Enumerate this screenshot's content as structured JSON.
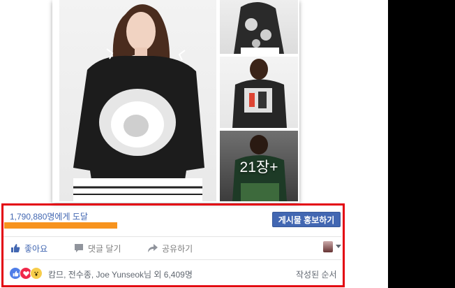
{
  "post": {
    "photo_more": "21장+",
    "reach_text": "1,790,880명에게 도달",
    "boost_button": "게시물 홍보하기",
    "actions": {
      "like": "좋아요",
      "comment": "댓글 달기",
      "share": "공유하기"
    },
    "reactions": {
      "types": [
        "like-icon",
        "love-icon",
        "wow-icon"
      ],
      "reactors_text": "캄므, 전수종, Joe Yunseok님 외 6,409명"
    },
    "sort_label": "작성된 순서"
  },
  "colors": {
    "link_blue": "#4267b2",
    "highlight_red": "#e3000f",
    "reach_bar_orange": "#f7931e"
  }
}
